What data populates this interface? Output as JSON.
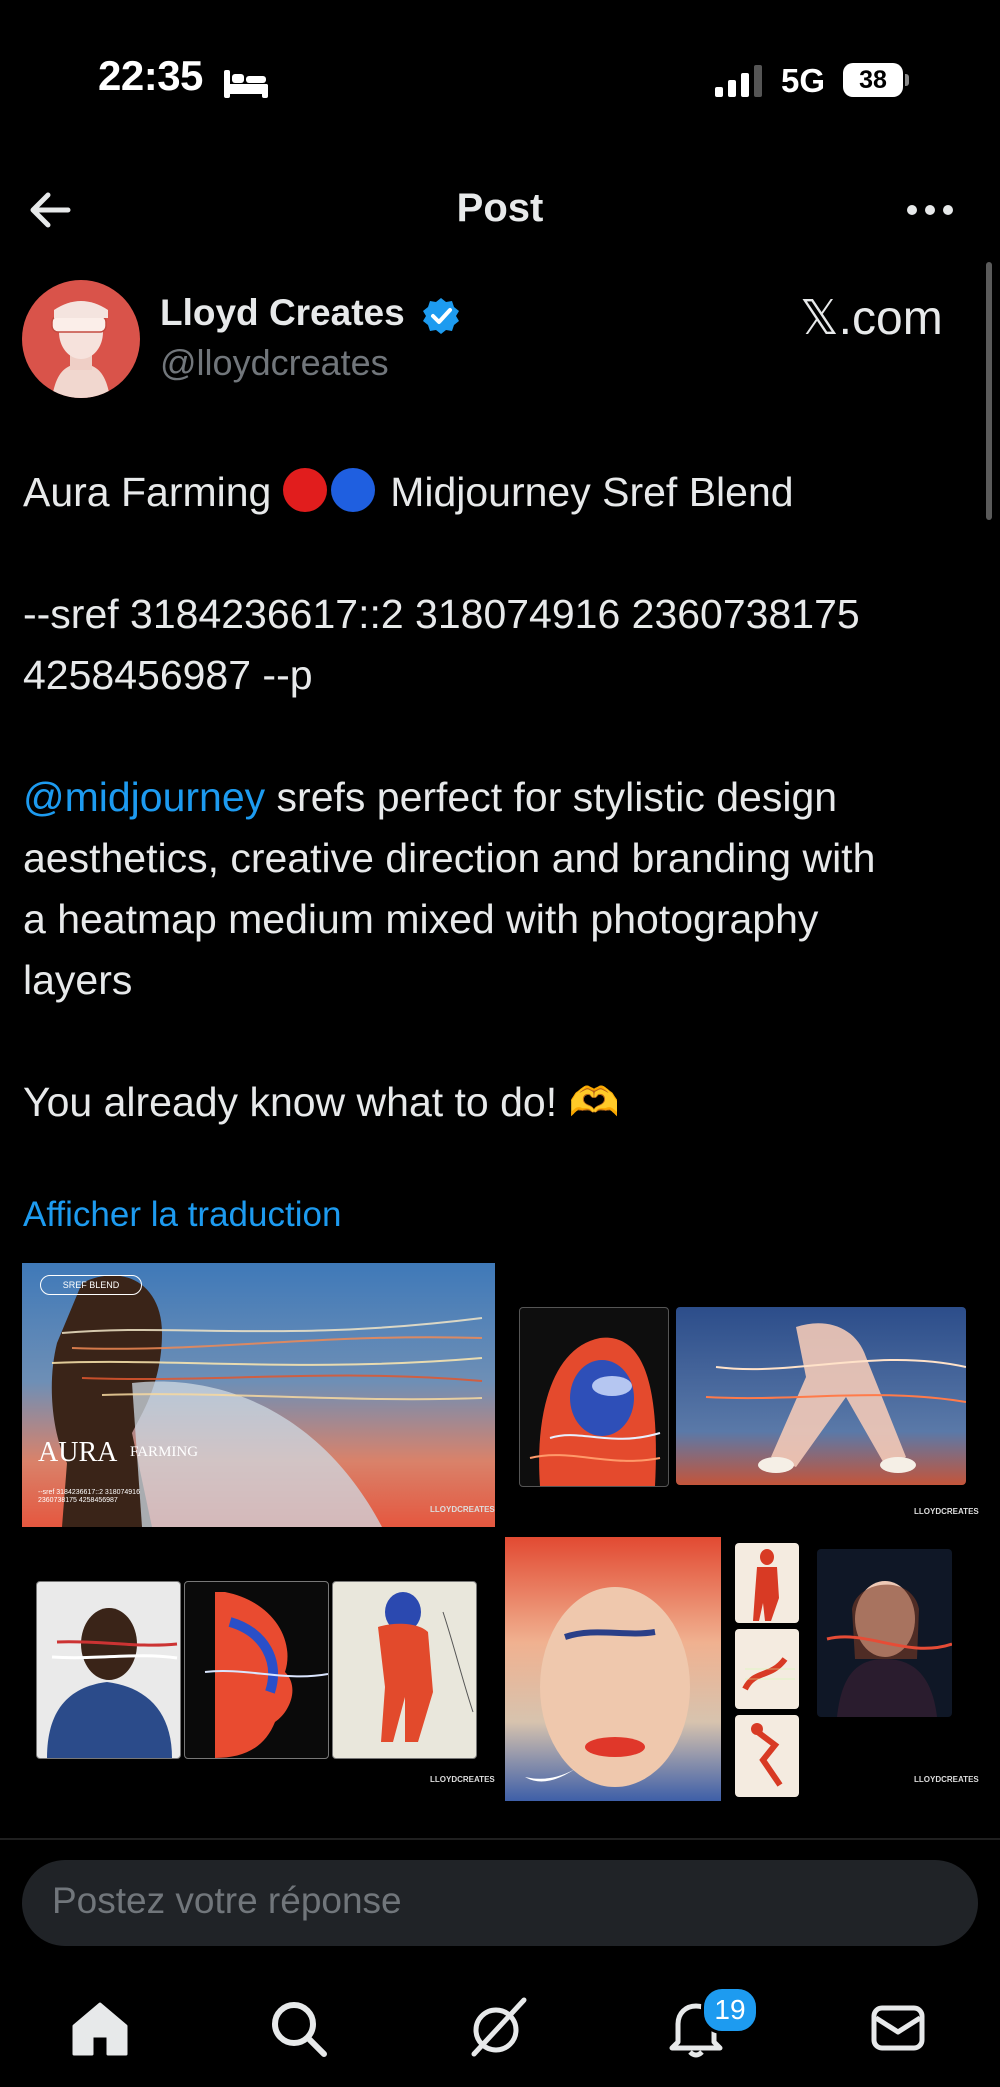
{
  "status_bar": {
    "time": "22:35",
    "network": "5G",
    "battery": "38"
  },
  "header": {
    "title": "Post"
  },
  "author": {
    "name": "Lloyd Creates",
    "handle": "@lloydcreates"
  },
  "watermark": "𝕏.com",
  "post": {
    "line1": "Aura Farming",
    "line1_suffix": "Midjourney Sref Blend",
    "sref_line1": "--sref 3184236617::2 318074916 2360738175",
    "sref_line2": "4258456987 --p",
    "mention": "@midjourney",
    "para_l1": " srefs perfect for stylistic design",
    "para_l2": "aesthetics, creative direction and branding with",
    "para_l3": "a heatmap medium mixed with photography",
    "para_l4": "layers",
    "closing": "You already know what to do!  🫶",
    "dot_colors": [
      "#e11d1d",
      "#1f5fe0"
    ]
  },
  "translate_link": "Afficher la traduction",
  "media": {
    "sref_tag": "SREF BLEND",
    "aura_title": "AURA",
    "aura_sub": "FARMING",
    "code_l1": "--sref 3184236617::2 318074916",
    "code_l2": "2360738175 4258456987",
    "signature": "LLOYDCREATES"
  },
  "reply": {
    "placeholder": "Postez votre réponse"
  },
  "tab_bar": {
    "notifications_badge": "19"
  },
  "colors": {
    "accent": "#1d9bf0",
    "background": "#000000",
    "text": "#e7e9ea",
    "muted": "#71767b"
  }
}
